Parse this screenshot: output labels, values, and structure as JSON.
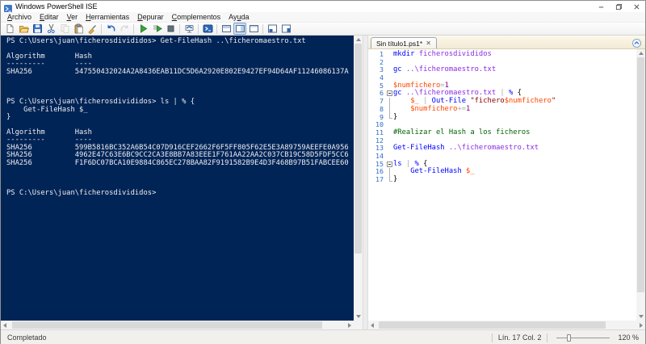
{
  "window": {
    "title": "Windows PowerShell ISE"
  },
  "menu": {
    "items": [
      {
        "label": "Archivo",
        "accel": 0
      },
      {
        "label": "Editar",
        "accel": 0
      },
      {
        "label": "Ver",
        "accel": 0
      },
      {
        "label": "Herramientas",
        "accel": 0
      },
      {
        "label": "Depurar",
        "accel": 0
      },
      {
        "label": "Complementos",
        "accel": 0
      },
      {
        "label": "Ayuda",
        "accel": 2
      }
    ]
  },
  "toolbar": {
    "items": [
      "new-script",
      "open-script",
      "save",
      "cut",
      "copy",
      "paste",
      "clear-console",
      "sep",
      "undo",
      "redo",
      "sep",
      "run-script",
      "run-selection",
      "stop",
      "sep",
      "new-remote-powershell-tab",
      "sep",
      "start-powershell",
      "sep",
      "script-pane-top",
      "script-pane-right",
      "script-pane-maximized",
      "sep",
      "show-command-addon",
      "new-powershell-tab"
    ],
    "selected": "script-pane-right",
    "disabled": [
      "copy",
      "redo"
    ]
  },
  "console": {
    "bg_color": "#012456",
    "lines": [
      "PS C:\\Users\\juan\\ficherosdivididos> Get-FileHash ..\\ficheromaestro.txt",
      "",
      "Algorithm       Hash",
      "---------       ----",
      "SHA256          547550432024A2A8436EAB11DC5D6A2920E802E9427EF94D64AF11246086137A",
      "",
      "",
      "",
      "PS C:\\Users\\juan\\ficherosdivididos> ls | % {",
      "    Get-FileHash $_",
      "}",
      "",
      "Algorithm       Hash",
      "---------       ----",
      "SHA256          599B5816BC352A6B54C07D916CEF2662F6F5FF805F62E5E3A89759AEEFE0A956",
      "SHA256          4962E47C63E6BC9CC2CA3E8BB7A83EEE1F761AA22AA2C037CB19C58D5FDF5CC6",
      "SHA256          F1F6DC07BCA10E9884C865EC278BAA82F9191582B9E4D3F468B97B51FABCEE60",
      "",
      "",
      "",
      "PS C:\\Users\\juan\\ficherosdivididos> "
    ]
  },
  "editor": {
    "tab_label": "Sin título1.ps1*",
    "close_glyph": "✕",
    "token_colors": {
      "command": "#0000FF",
      "argument": "#8A2BE2",
      "variable": "#FF4500",
      "number": "#800080",
      "operator": "#A9A9A9",
      "string": "#8B0000",
      "comment": "#006400",
      "plain": "#000000",
      "line_number": "#2F6CC0"
    },
    "lines": [
      {
        "n": 1,
        "fold": "",
        "tokens": [
          [
            "cmd",
            "mkdir"
          ],
          [
            "pln",
            " "
          ],
          [
            "arg",
            "ficherosdivididos"
          ]
        ]
      },
      {
        "n": 2,
        "fold": "",
        "tokens": []
      },
      {
        "n": 3,
        "fold": "",
        "tokens": [
          [
            "cmd",
            "gc"
          ],
          [
            "pln",
            " "
          ],
          [
            "arg",
            "..\\ficheromaestro.txt"
          ]
        ]
      },
      {
        "n": 4,
        "fold": "",
        "tokens": []
      },
      {
        "n": 5,
        "fold": "",
        "tokens": [
          [
            "var",
            "$numfichero"
          ],
          [
            "op",
            "="
          ],
          [
            "num",
            "1"
          ]
        ]
      },
      {
        "n": 6,
        "fold": "start",
        "tokens": [
          [
            "cmd",
            "gc"
          ],
          [
            "pln",
            " "
          ],
          [
            "arg",
            "..\\ficheromaestro.txt"
          ],
          [
            "pln",
            " "
          ],
          [
            "op",
            "|"
          ],
          [
            "pln",
            " "
          ],
          [
            "cmd",
            "%"
          ],
          [
            "pln",
            " {"
          ]
        ]
      },
      {
        "n": 7,
        "fold": "mid",
        "tokens": [
          [
            "pln",
            "    "
          ],
          [
            "var",
            "$_"
          ],
          [
            "pln",
            " "
          ],
          [
            "op",
            "|"
          ],
          [
            "pln",
            " "
          ],
          [
            "cmd",
            "Out-File"
          ],
          [
            "pln",
            " "
          ],
          [
            "str",
            "\"fichero"
          ],
          [
            "var",
            "$numfichero"
          ],
          [
            "str",
            "\""
          ]
        ]
      },
      {
        "n": 8,
        "fold": "mid",
        "tokens": [
          [
            "pln",
            "    "
          ],
          [
            "var",
            "$numfichero"
          ],
          [
            "op",
            "+="
          ],
          [
            "num",
            "1"
          ]
        ]
      },
      {
        "n": 9,
        "fold": "end",
        "tokens": [
          [
            "pln",
            "}"
          ]
        ]
      },
      {
        "n": 10,
        "fold": "",
        "tokens": []
      },
      {
        "n": 11,
        "fold": "",
        "tokens": [
          [
            "com",
            "#Realizar el Hash a los ficheros"
          ]
        ]
      },
      {
        "n": 12,
        "fold": "",
        "tokens": []
      },
      {
        "n": 13,
        "fold": "",
        "tokens": [
          [
            "cmd",
            "Get-FileHash"
          ],
          [
            "pln",
            " "
          ],
          [
            "arg",
            "..\\ficheromaestro.txt"
          ]
        ]
      },
      {
        "n": 14,
        "fold": "",
        "tokens": []
      },
      {
        "n": 15,
        "fold": "start",
        "tokens": [
          [
            "cmd",
            "ls"
          ],
          [
            "pln",
            " "
          ],
          [
            "op",
            "|"
          ],
          [
            "pln",
            " "
          ],
          [
            "cmd",
            "%"
          ],
          [
            "pln",
            " {"
          ]
        ]
      },
      {
        "n": 16,
        "fold": "mid",
        "tokens": [
          [
            "pln",
            "    "
          ],
          [
            "cmd",
            "Get-FileHash"
          ],
          [
            "pln",
            " "
          ],
          [
            "var",
            "$_"
          ]
        ]
      },
      {
        "n": 17,
        "fold": "end",
        "tokens": [
          [
            "pln",
            "}"
          ]
        ]
      }
    ]
  },
  "statusbar": {
    "status": "Completado",
    "line_col": "Lín. 17 Col. 2",
    "zoom_label": "120 %",
    "zoom_percent": 120
  }
}
